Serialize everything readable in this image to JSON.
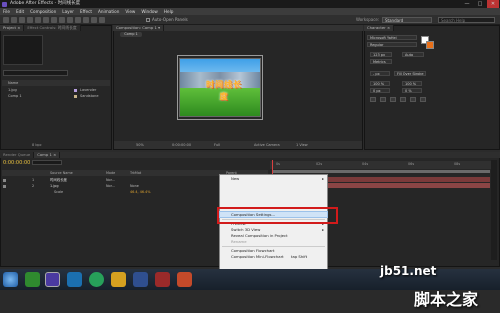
{
  "window": {
    "title": "Adobe After Effects - 时间线长度",
    "minimize": "—",
    "maximize": "□",
    "close": "✕"
  },
  "menu": [
    "File",
    "Edit",
    "Composition",
    "Layer",
    "Effect",
    "Animation",
    "View",
    "Window",
    "Help"
  ],
  "toolbar": {
    "auto_open": "Auto-Open Panels",
    "workspace_label": "Workspace:",
    "workspace_value": "Standard",
    "search_placeholder": "Search Help"
  },
  "project": {
    "tab": "Project ×",
    "tab2": "Effect Controls: 时间线长度",
    "search": "",
    "header": "Name",
    "items": [
      {
        "name": "1.jpg",
        "label": "Lavender"
      },
      {
        "name": "Comp 1",
        "label": "Sandstone"
      }
    ],
    "footer": "8 bpc"
  },
  "comp": {
    "tab": "Composition: Comp 1 ▾",
    "breadcrumb": "Comp 1",
    "banner": "时间线长度",
    "zoom": "50%",
    "timecode": "0:00:00:00",
    "resolution": "Full",
    "camera": "Active Camera",
    "view": "1 View"
  },
  "character": {
    "tab": "Character ×",
    "font": "Microsoft YaHei",
    "style": "Regular",
    "size": "123 px",
    "leading": "Auto",
    "tracking": "Metrics",
    "stroke": "Fill Over Stroke",
    "stroke_px": "- px",
    "vscale": "100 %",
    "hscale": "100 %",
    "baseline": "0 px",
    "tsume": "0 %"
  },
  "timeline": {
    "tab1": "Render Queue",
    "tab2": "Comp 1 ×",
    "timecode": "0:00:00:00",
    "headers": {
      "source": "Source Name",
      "mode": "Mode",
      "trkmat": "TrkMat",
      "parent": "Parent"
    },
    "layers": [
      {
        "num": "1",
        "name": "时间线长度",
        "mode": "Nor...",
        "parent": "None"
      },
      {
        "num": "2",
        "name": "1.jpg",
        "mode": "Nor...",
        "trkmat": "None",
        "parent": "None"
      }
    ],
    "sub": {
      "label": "Scale",
      "value": "46.4, 46.4%"
    },
    "ruler": [
      "0s",
      "02s",
      "04s",
      "06s",
      "08s"
    ]
  },
  "context_menu": {
    "items": [
      {
        "label": "New",
        "arrow": "▸",
        "disabled": false
      },
      {
        "label": "Composition Settings...",
        "disabled": false,
        "highlighted": true
      },
      {
        "label": "Preview",
        "arrow": "▸",
        "disabled": false
      },
      {
        "label": "Switch 3D View",
        "arrow": "▸",
        "disabled": false
      },
      {
        "label": "Reveal Composition in Project",
        "disabled": false
      },
      {
        "label": "Rename",
        "disabled": true
      },
      {
        "label": "Composition Flowchart",
        "disabled": false
      },
      {
        "label": "Composition Mini-Flowchart",
        "shortcut": "tap Shift",
        "disabled": false
      }
    ]
  },
  "watermark": {
    "site": "jb51.net",
    "name": "脚本之家"
  }
}
